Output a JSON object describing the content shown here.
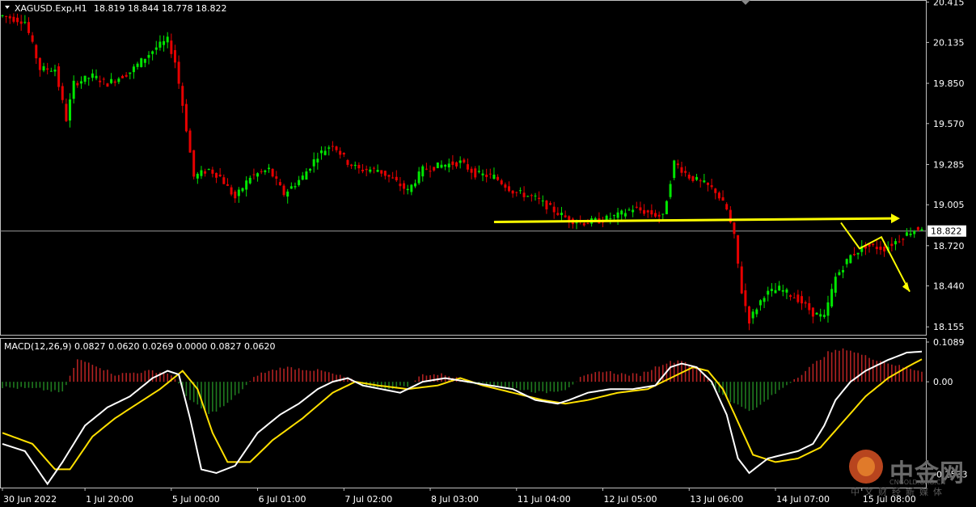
{
  "header": {
    "symbol": "XAGUSD.Exp,H1",
    "ohlc": "18.819 18.844 18.778 18.822"
  },
  "macd": {
    "label": "MACD(12,26,9) 0.0827 0.0620 0.0269 0.0000 0.0827 0.0620"
  },
  "colors": {
    "bull": "#00e600",
    "bear": "#e60000",
    "hist_pos": "#b22222",
    "hist_neg": "#1f7a1f",
    "macd": "#ffffff",
    "signal": "#ffe000",
    "annot": "#ffff00",
    "grid": "#c0c0c0"
  },
  "watermark": {
    "brand": "中金网",
    "url": "CNGOLD.ORG.CN",
    "sub": "中文财经新媒体"
  },
  "chart_data": [
    {
      "type": "candlestick",
      "title": "XAGUSD.Exp,H1",
      "yticks": [
        "20.415",
        "20.135",
        "19.850",
        "19.570",
        "19.285",
        "19.005",
        "18.720",
        "18.440",
        "18.155"
      ],
      "ylim": [
        18.1,
        20.43
      ],
      "current_price": "18.822",
      "x_ticks": [
        "30 Jun 2022",
        "1 Jul 20:00",
        "5 Jul 00:00",
        "6 Jul 01:00",
        "7 Jul 02:00",
        "8 Jul 03:00",
        "11 Jul 04:00",
        "12 Jul 05:00",
        "13 Jul 06:00",
        "14 Jul 07:00",
        "15 Jul 08:00"
      ],
      "close_path": [
        [
          0,
          20.32
        ],
        [
          6,
          20.28
        ],
        [
          10,
          19.95
        ],
        [
          14,
          19.95
        ],
        [
          17,
          19.6
        ],
        [
          19,
          19.85
        ],
        [
          24,
          19.9
        ],
        [
          28,
          19.85
        ],
        [
          34,
          19.93
        ],
        [
          38,
          20.03
        ],
        [
          41,
          20.1
        ],
        [
          44,
          20.15
        ],
        [
          46,
          20.0
        ],
        [
          48,
          19.7
        ],
        [
          51,
          19.2
        ],
        [
          55,
          19.25
        ],
        [
          58,
          19.2
        ],
        [
          62,
          19.05
        ],
        [
          66,
          19.2
        ],
        [
          71,
          19.25
        ],
        [
          75,
          19.08
        ],
        [
          80,
          19.2
        ],
        [
          84,
          19.35
        ],
        [
          88,
          19.43
        ],
        [
          92,
          19.3
        ],
        [
          95,
          19.25
        ],
        [
          100,
          19.25
        ],
        [
          104,
          19.18
        ],
        [
          108,
          19.1
        ],
        [
          112,
          19.25
        ],
        [
          117,
          19.28
        ],
        [
          122,
          19.3
        ],
        [
          126,
          19.22
        ],
        [
          131,
          19.2
        ],
        [
          136,
          19.1
        ],
        [
          142,
          19.05
        ],
        [
          146,
          18.98
        ],
        [
          151,
          18.9
        ],
        [
          155,
          18.88
        ],
        [
          160,
          18.9
        ],
        [
          164,
          18.93
        ],
        [
          168,
          18.98
        ],
        [
          172,
          18.95
        ],
        [
          176,
          18.92
        ],
        [
          179,
          19.3
        ],
        [
          183,
          19.2
        ],
        [
          187,
          19.15
        ],
        [
          190,
          19.1
        ],
        [
          193,
          18.97
        ],
        [
          195,
          18.78
        ],
        [
          197,
          18.4
        ],
        [
          199,
          18.2
        ],
        [
          203,
          18.38
        ],
        [
          207,
          18.42
        ],
        [
          212,
          18.35
        ],
        [
          216,
          18.25
        ],
        [
          219,
          18.22
        ],
        [
          222,
          18.5
        ],
        [
          226,
          18.65
        ],
        [
          230,
          18.72
        ],
        [
          235,
          18.7
        ],
        [
          238,
          18.75
        ],
        [
          242,
          18.82
        ],
        [
          245,
          18.85
        ]
      ],
      "annotations": {
        "resistance_level": 18.91,
        "forecast": [
          [
            18.88
          ],
          [
            18.7
          ],
          [
            18.78
          ],
          [
            18.4
          ]
        ]
      }
    },
    {
      "type": "macd",
      "title": "MACD(12,26,9)",
      "yticks": [
        "0.1089",
        "0.00",
        "-0.2533"
      ],
      "ylim": [
        -0.29,
        0.12
      ],
      "values": {
        "macd": 0.0827,
        "signal": 0.062
      },
      "hist_keys": [
        [
          0,
          -0.015
        ],
        [
          10,
          -0.02
        ],
        [
          16,
          -0.03
        ],
        [
          20,
          0.06
        ],
        [
          24,
          0.05
        ],
        [
          30,
          0.02
        ],
        [
          40,
          0.03
        ],
        [
          45,
          0.02
        ],
        [
          50,
          -0.05
        ],
        [
          55,
          -0.09
        ],
        [
          60,
          -0.06
        ],
        [
          64,
          -0.02
        ],
        [
          68,
          0.02
        ],
        [
          75,
          0.04
        ],
        [
          85,
          0.03
        ],
        [
          92,
          0.01
        ],
        [
          96,
          -0.01
        ],
        [
          102,
          -0.02
        ],
        [
          108,
          -0.01
        ],
        [
          112,
          0.02
        ],
        [
          118,
          0.02
        ],
        [
          124,
          0.0
        ],
        [
          130,
          -0.01
        ],
        [
          138,
          -0.02
        ],
        [
          144,
          -0.03
        ],
        [
          150,
          -0.02
        ],
        [
          154,
          0.01
        ],
        [
          160,
          0.03
        ],
        [
          166,
          0.02
        ],
        [
          170,
          0.02
        ],
        [
          176,
          0.05
        ],
        [
          181,
          0.06
        ],
        [
          186,
          0.03
        ],
        [
          190,
          -0.02
        ],
        [
          195,
          -0.06
        ],
        [
          200,
          -0.08
        ],
        [
          205,
          -0.04
        ],
        [
          210,
          0.0
        ],
        [
          214,
          0.03
        ],
        [
          220,
          0.08
        ],
        [
          225,
          0.09
        ],
        [
          230,
          0.07
        ],
        [
          240,
          0.04
        ],
        [
          245,
          0.03
        ]
      ],
      "macd_keys": [
        [
          0,
          -0.17
        ],
        [
          6,
          -0.19
        ],
        [
          10,
          -0.25
        ],
        [
          12,
          -0.28
        ],
        [
          16,
          -0.22
        ],
        [
          22,
          -0.12
        ],
        [
          28,
          -0.07
        ],
        [
          34,
          -0.04
        ],
        [
          40,
          0.01
        ],
        [
          44,
          0.03
        ],
        [
          47,
          0.02
        ],
        [
          50,
          -0.1
        ],
        [
          53,
          -0.24
        ],
        [
          57,
          -0.25
        ],
        [
          62,
          -0.23
        ],
        [
          68,
          -0.14
        ],
        [
          74,
          -0.09
        ],
        [
          79,
          -0.06
        ],
        [
          84,
          -0.02
        ],
        [
          88,
          0.0
        ],
        [
          92,
          0.01
        ],
        [
          96,
          -0.01
        ],
        [
          101,
          -0.02
        ],
        [
          106,
          -0.03
        ],
        [
          112,
          0.0
        ],
        [
          118,
          0.01
        ],
        [
          124,
          0.0
        ],
        [
          130,
          -0.01
        ],
        [
          136,
          -0.02
        ],
        [
          142,
          -0.05
        ],
        [
          148,
          -0.06
        ],
        [
          151,
          -0.05
        ],
        [
          156,
          -0.03
        ],
        [
          162,
          -0.02
        ],
        [
          168,
          -0.02
        ],
        [
          174,
          -0.01
        ],
        [
          178,
          0.04
        ],
        [
          181,
          0.05
        ],
        [
          185,
          0.04
        ],
        [
          189,
          0.0
        ],
        [
          193,
          -0.09
        ],
        [
          196,
          -0.21
        ],
        [
          199,
          -0.25
        ],
        [
          204,
          -0.21
        ],
        [
          208,
          -0.2
        ],
        [
          212,
          -0.19
        ],
        [
          216,
          -0.17
        ],
        [
          219,
          -0.12
        ],
        [
          222,
          -0.05
        ],
        [
          226,
          0.0
        ],
        [
          230,
          0.03
        ],
        [
          236,
          0.06
        ],
        [
          241,
          0.08
        ],
        [
          245,
          0.0827
        ]
      ],
      "signal_keys": [
        [
          0,
          -0.14
        ],
        [
          8,
          -0.17
        ],
        [
          14,
          -0.24
        ],
        [
          18,
          -0.24
        ],
        [
          24,
          -0.15
        ],
        [
          30,
          -0.1
        ],
        [
          36,
          -0.06
        ],
        [
          42,
          -0.02
        ],
        [
          48,
          0.03
        ],
        [
          52,
          -0.02
        ],
        [
          56,
          -0.14
        ],
        [
          60,
          -0.22
        ],
        [
          66,
          -0.22
        ],
        [
          72,
          -0.16
        ],
        [
          80,
          -0.1
        ],
        [
          88,
          -0.03
        ],
        [
          94,
          0.0
        ],
        [
          100,
          -0.01
        ],
        [
          108,
          -0.02
        ],
        [
          116,
          -0.01
        ],
        [
          122,
          0.01
        ],
        [
          128,
          -0.01
        ],
        [
          136,
          -0.03
        ],
        [
          144,
          -0.05
        ],
        [
          150,
          -0.06
        ],
        [
          156,
          -0.05
        ],
        [
          164,
          -0.03
        ],
        [
          172,
          -0.02
        ],
        [
          178,
          0.01
        ],
        [
          184,
          0.04
        ],
        [
          188,
          0.03
        ],
        [
          192,
          -0.02
        ],
        [
          196,
          -0.11
        ],
        [
          200,
          -0.2
        ],
        [
          206,
          -0.22
        ],
        [
          212,
          -0.21
        ],
        [
          218,
          -0.18
        ],
        [
          224,
          -0.11
        ],
        [
          230,
          -0.04
        ],
        [
          236,
          0.01
        ],
        [
          241,
          0.04
        ],
        [
          245,
          0.062
        ]
      ]
    }
  ]
}
